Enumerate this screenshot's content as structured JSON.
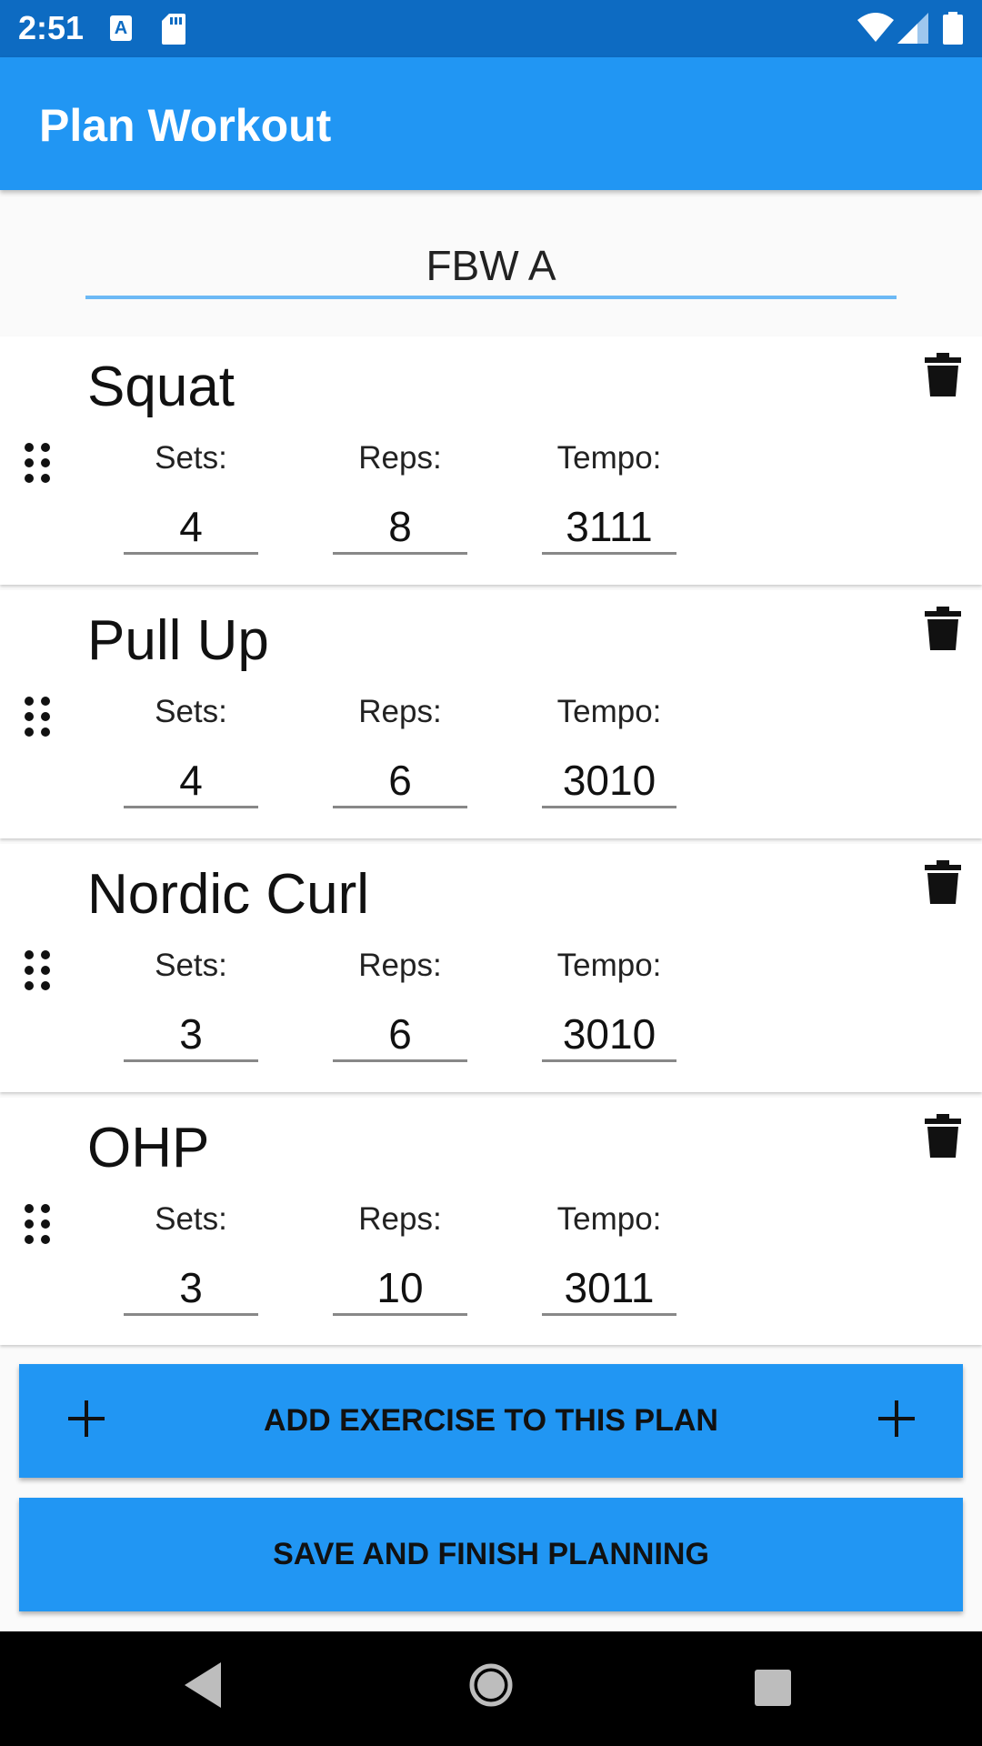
{
  "status_bar": {
    "time": "2:51",
    "a_badge": "A"
  },
  "app_bar": {
    "title": "Plan Workout"
  },
  "plan": {
    "name": "FBW A"
  },
  "exercises": [
    {
      "name": "Squat",
      "sets_label": "Sets:",
      "reps_label": "Reps:",
      "tempo_label": "Tempo:",
      "sets": "4",
      "reps": "8",
      "tempo": "3111"
    },
    {
      "name": "Pull Up",
      "sets_label": "Sets:",
      "reps_label": "Reps:",
      "tempo_label": "Tempo:",
      "sets": "4",
      "reps": "6",
      "tempo": "3010"
    },
    {
      "name": "Nordic Curl",
      "sets_label": "Sets:",
      "reps_label": "Reps:",
      "tempo_label": "Tempo:",
      "sets": "3",
      "reps": "6",
      "tempo": "3010"
    },
    {
      "name": "OHP",
      "sets_label": "Sets:",
      "reps_label": "Reps:",
      "tempo_label": "Tempo:",
      "sets": "3",
      "reps": "10",
      "tempo": "3011"
    }
  ],
  "buttons": {
    "add_exercise": "ADD EXERCISE TO THIS PLAN",
    "save_finish": "SAVE AND FINISH PLANNING"
  },
  "colors": {
    "status_bar": "#0d6bc2",
    "primary": "#2196f3",
    "input_underline": "#6cb9f5"
  },
  "icons": [
    "drag-handle-icon",
    "trash-icon",
    "plus-icon",
    "back-icon",
    "home-icon",
    "recents-icon"
  ]
}
